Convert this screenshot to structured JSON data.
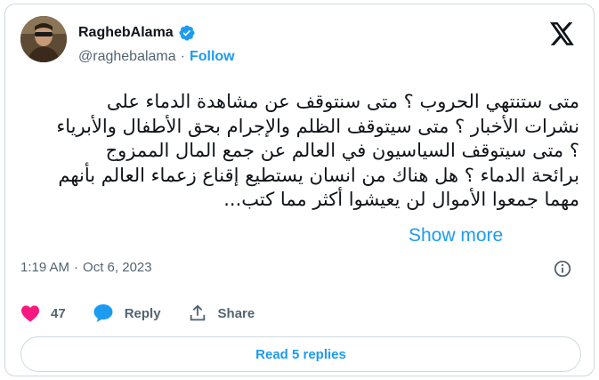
{
  "tweet": {
    "author": {
      "name": "RaghebAlama",
      "handle": "@raghebalama",
      "follow_label": "Follow",
      "avatar_icon": "avatar-photo",
      "verified_icon": "verified-badge-icon"
    },
    "brand_icon": "x-logo-icon",
    "text": "متى ستنتهي الحروب ؟ متى سنتوقف عن مشاهدة الدماء على نشرات الأخبار ؟ متى سيتوقف الظلم والإجرام بحق الأطفال والأبرياء ؟ متى سيتوقف السياسيون في العالم عن جمع المال الممزوج برائحة الدماء ؟ هل هناك من انسان يستطيع إقناع زعماء العالم بأنهم مهما جمعوا الأموال لن يعيشوا أكثر مما كتب...",
    "show_more_label": "Show more",
    "time": "1:19 AM",
    "date": "Oct 6, 2023",
    "separator": "·",
    "likes_count": "47",
    "reply_label": "Reply",
    "share_label": "Share",
    "read_replies_label": "Read 5 replies"
  },
  "colors": {
    "accent": "#1d9bf0",
    "like": "#f91880",
    "text": "#0f1419",
    "muted": "#536471",
    "border": "#cfd9de"
  }
}
